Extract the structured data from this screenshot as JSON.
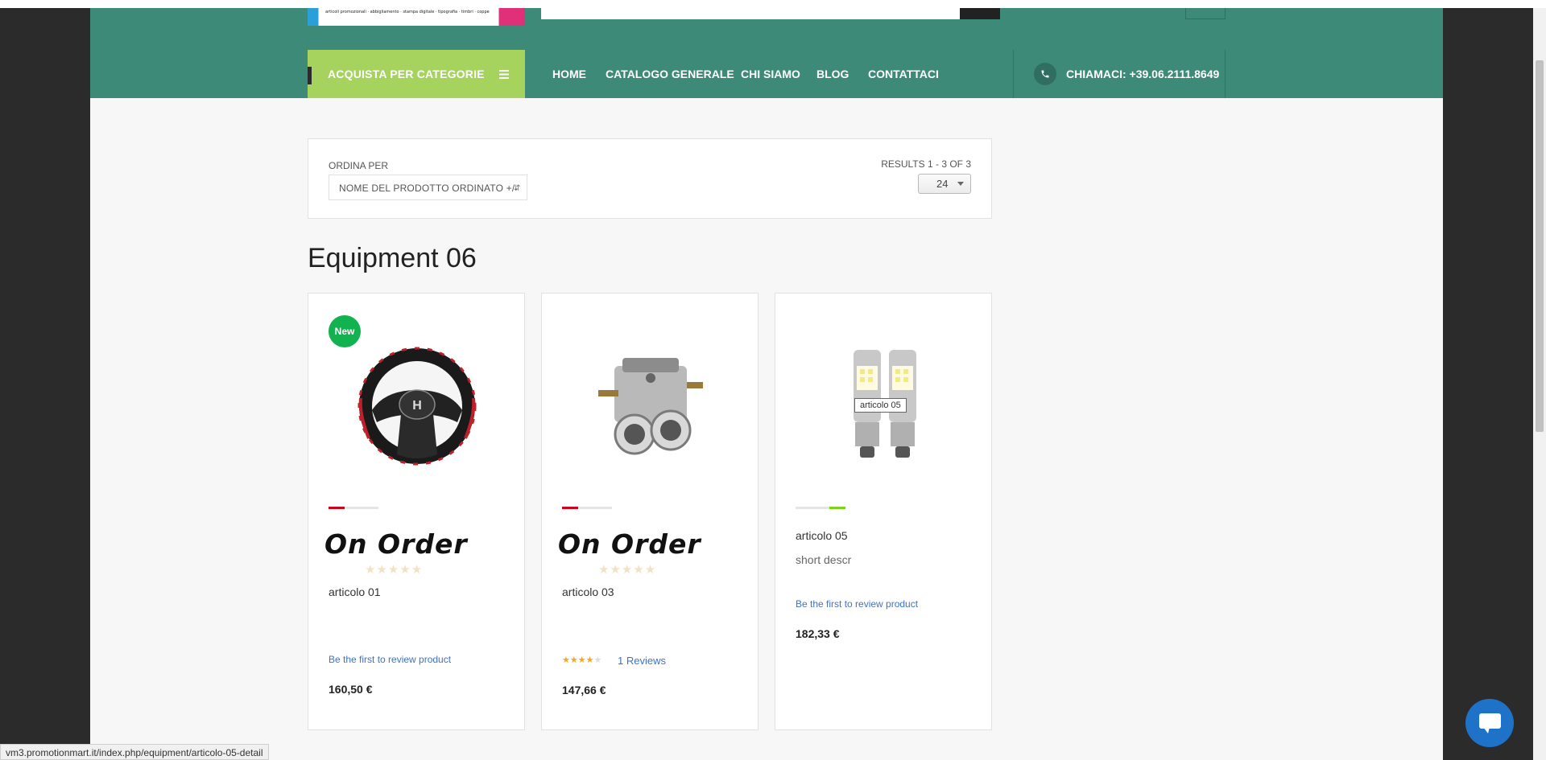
{
  "header": {
    "logo_tagline": "articoli promozionali · abbigliamento · stampa digitale · tipografia · timbri · coppe"
  },
  "nav": {
    "category_button": "ACQUISTA PER CATEGORIE",
    "items": [
      "HOME",
      "CATALOGO GENERALE",
      "CHI SIAMO",
      "BLOG",
      "CONTATTACI"
    ],
    "phone": "CHIAMACI: +39.06.2111.8649"
  },
  "sort": {
    "label": "ORDINA PER",
    "selected": "NOME DEL PRODOTTO ORDINATO +/-",
    "results": "RESULTS 1 - 3 OF 3",
    "limit": "24"
  },
  "category": {
    "title": "Equipment 06"
  },
  "products": [
    {
      "badge": "New",
      "availability_image_text": "On Order",
      "availability_color": "#d0021b",
      "name": "articolo 01",
      "review_link": "Be the first to review product",
      "price": "160,50 €"
    },
    {
      "availability_image_text": "On Order",
      "availability_color": "#d0021b",
      "name": "articolo 03",
      "rating": 4,
      "review_count": "1 Reviews",
      "price": "147,66 €"
    },
    {
      "availability_color": "#7ed321",
      "name": "articolo 05",
      "short_desc": "short descr",
      "review_link": "Be the first to review product",
      "price": "182,33 €",
      "tooltip": "articolo 05"
    }
  ],
  "status_bar": {
    "url": "vm3.promotionmart.it/index.php/equipment/articolo-05-detail"
  },
  "colors": {
    "header_green": "#3d8a79",
    "category_green": "#a5d35e",
    "new_badge": "#11b24f",
    "link_blue": "#3d73c9",
    "chat_blue": "#1e73c9"
  }
}
